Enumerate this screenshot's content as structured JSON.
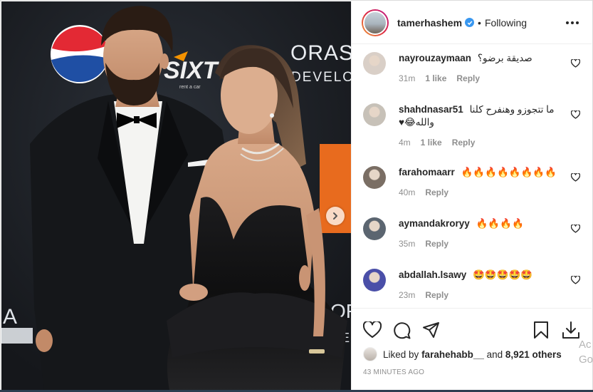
{
  "post": {
    "username": "tamerhashem",
    "follow_status": "Following",
    "dot": "•",
    "likes_prefix": "Liked by",
    "liked_by_user": "farahehabb__",
    "likes_and": "and",
    "likes_others": "8,921 others",
    "time_ago": "43 MINUTES AGO"
  },
  "photo_sign": {
    "oras_top": "ORAS",
    "oras_sub": "DEVELO",
    "sixt": "SIXT",
    "sixt_sub": "rent a car",
    "right_ora": "ORA",
    "right_deve": "DEVE",
    "left_a": "A"
  },
  "comments": [
    {
      "username": "nayrouzaymaan",
      "text": "صديقة برضو؟",
      "time": "31m",
      "likes": "1 like",
      "reply": "Reply",
      "avatar_color": "#d9cfc7"
    },
    {
      "username": "shahdnasar51",
      "text": "ما تتجوزو وهنفرح كلنا والله😂♥",
      "time": "4m",
      "likes": "1 like",
      "reply": "Reply",
      "avatar_color": "#c7c1b8"
    },
    {
      "username": "farahomaarr",
      "text": "🔥🔥🔥🔥🔥🔥🔥🔥",
      "time": "40m",
      "likes": "",
      "reply": "Reply",
      "avatar_color": "#7a6e64"
    },
    {
      "username": "aymandakroryy",
      "text": "🔥🔥🔥🔥",
      "time": "35m",
      "likes": "",
      "reply": "Reply",
      "avatar_color": "#5b6570"
    },
    {
      "username": "abdallah.lsawy",
      "text": "🤩🤩🤩🤩🤩",
      "time": "23m",
      "likes": "",
      "reply": "Reply",
      "avatar_color": "#4a4fa8"
    }
  ],
  "watermark": {
    "line1": "Ac",
    "line2": "Go"
  },
  "icons": [
    "verified-badge-icon",
    "more-options-icon",
    "heart-icon",
    "comment-icon",
    "share-icon",
    "save-icon",
    "chevron-right-icon"
  ]
}
